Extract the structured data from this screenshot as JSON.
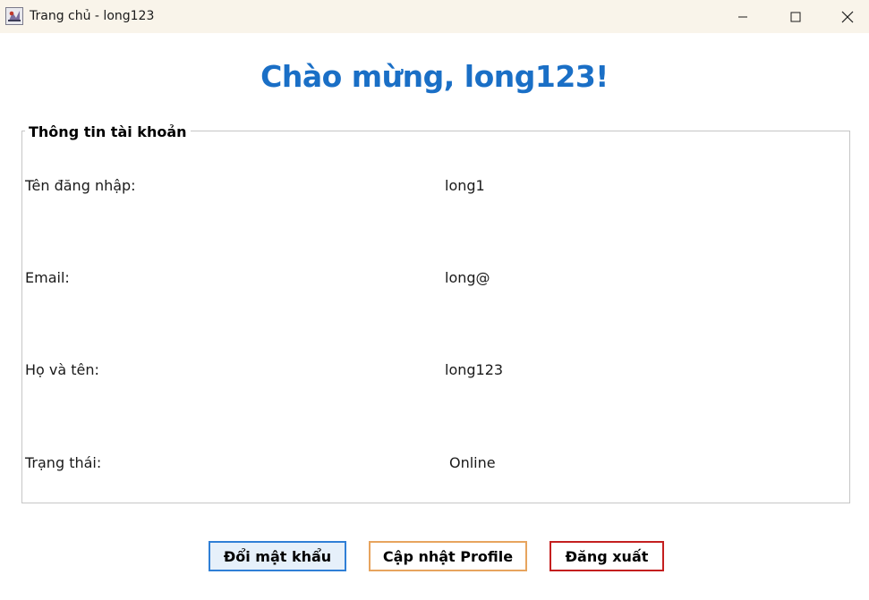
{
  "window": {
    "title": "Trang chủ - long123",
    "icon": "java-app-icon",
    "controls": [
      "minimize-icon",
      "maximize-icon",
      "close-icon"
    ]
  },
  "header": {
    "welcome": "Chào mừng, long123!"
  },
  "account_panel": {
    "legend": "Thông tin tài khoản",
    "rows": [
      {
        "label": "Tên đăng nhập:",
        "value": "long1"
      },
      {
        "label": "Email:",
        "value": "long@"
      },
      {
        "label": "Họ và tên:",
        "value": "long123"
      },
      {
        "label": "Trạng thái:",
        "value": "Online"
      }
    ]
  },
  "buttons": {
    "change_password": "Đổi mật khẩu",
    "update_profile": "Cập nhật Profile",
    "logout": "Đăng xuất"
  },
  "colors": {
    "title_blue": "#1a6fc6",
    "change_border": "#2f7fd6",
    "profile_border": "#e7a45e",
    "logout_border": "#c41f1f"
  }
}
